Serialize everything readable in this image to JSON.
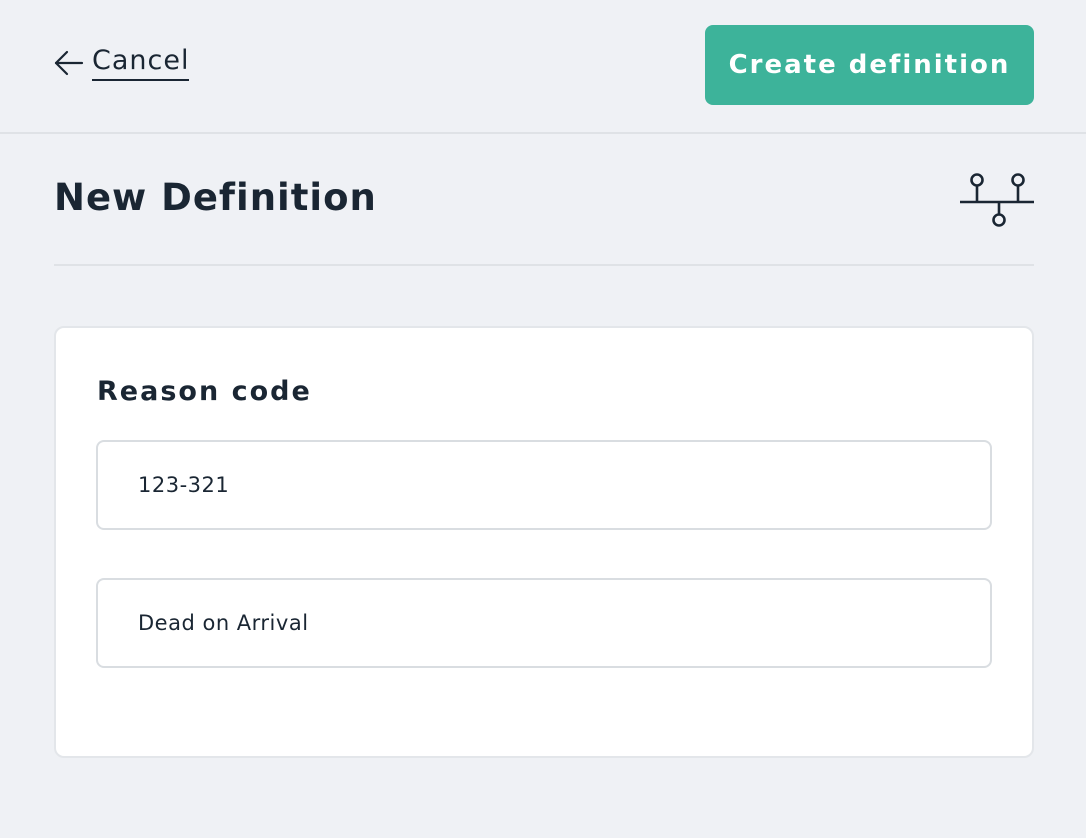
{
  "header": {
    "cancel_label": "Cancel",
    "create_label": "Create definition"
  },
  "page": {
    "title": "New Definition"
  },
  "form": {
    "section_title": "Reason code",
    "code_value": "123-321",
    "description_value": "Dead on Arrival"
  },
  "colors": {
    "primary": "#3db39a",
    "background": "#eff1f5",
    "text": "#1a2633"
  },
  "icons": {
    "back": "arrow-left-icon",
    "definition": "tree-structure-icon"
  }
}
